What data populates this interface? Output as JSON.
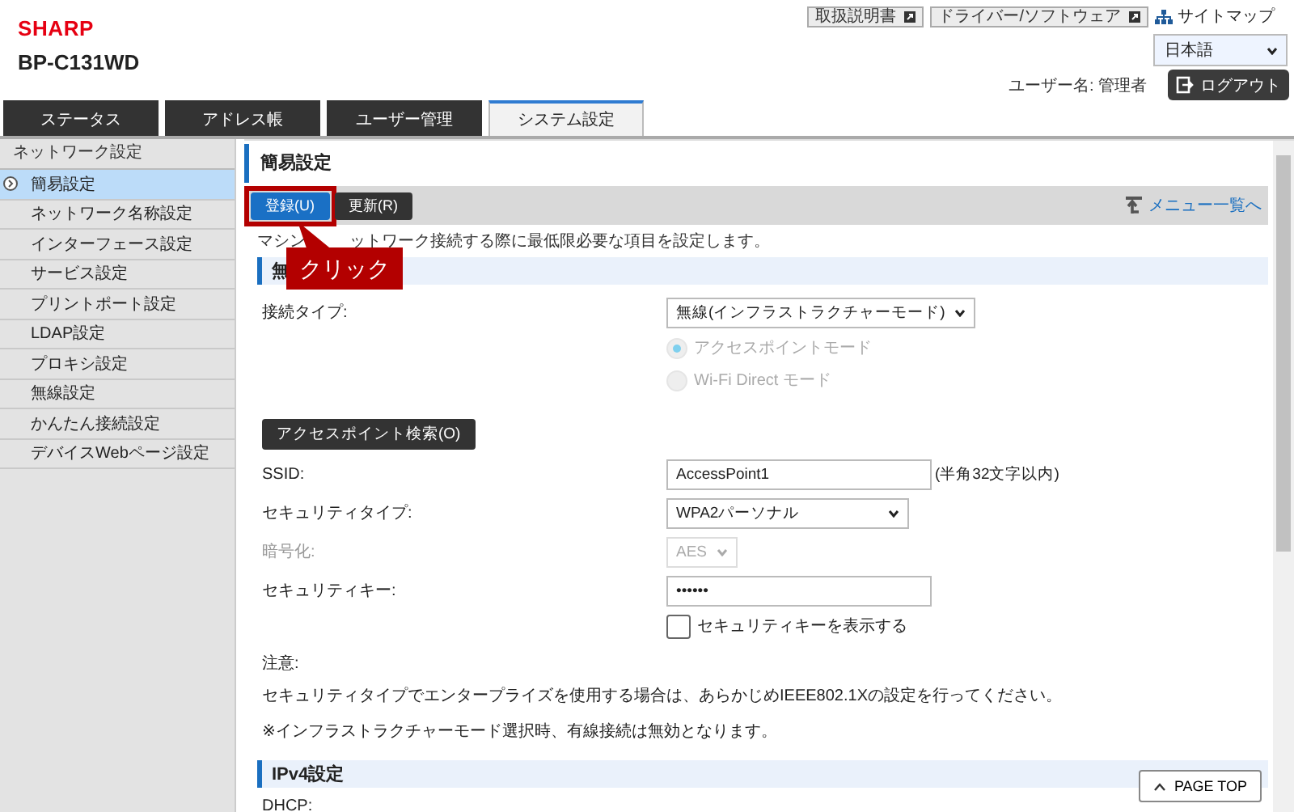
{
  "header": {
    "logo": "SHARP",
    "model": "BP-C131WD",
    "links": [
      {
        "label": "取扱説明書",
        "kind": "external"
      },
      {
        "label": "ドライバー/ソフトウェア",
        "kind": "external"
      },
      {
        "label": "サイトマップ",
        "kind": "sitemap"
      }
    ],
    "language": "日本語",
    "user_label": "ユーザー名: 管理者",
    "logout": "ログアウト"
  },
  "tabs": [
    {
      "label": "ステータス",
      "selected": false
    },
    {
      "label": "アドレス帳",
      "selected": false
    },
    {
      "label": "ユーザー管理",
      "selected": false
    },
    {
      "label": "システム設定",
      "selected": true
    }
  ],
  "sidebar": {
    "heading": "ネットワーク設定",
    "items": [
      {
        "label": "簡易設定",
        "selected": true
      },
      {
        "label": "ネットワーク名称設定",
        "selected": false
      },
      {
        "label": "インターフェース設定",
        "selected": false
      },
      {
        "label": "サービス設定",
        "selected": false
      },
      {
        "label": "プリントポート設定",
        "selected": false
      },
      {
        "label": "LDAP設定",
        "selected": false
      },
      {
        "label": "プロキシ設定",
        "selected": false
      },
      {
        "label": "無線設定",
        "selected": false
      },
      {
        "label": "かんたん接続設定",
        "selected": false
      },
      {
        "label": "デバイスWebページ設定",
        "selected": false
      }
    ]
  },
  "page": {
    "title": "簡易設定",
    "buttons": [
      {
        "label": "登録(U)",
        "kind": "primary",
        "highlighted": true
      },
      {
        "label": "更新(R)",
        "kind": "secondary",
        "highlighted": false
      }
    ],
    "menu_link": "メニュー一覧へ",
    "description_parts": [
      "マシン",
      "ットワーク接続する際に最低限必要な項目を設定します。"
    ],
    "section": "無",
    "callout": "クリック",
    "form": [
      {
        "kind": "select",
        "label": "接続タイプ:",
        "value": "無線(インフラストラクチャーモード)",
        "disabled": false
      },
      {
        "kind": "radio",
        "label": "アクセスポイントモード",
        "selected": true,
        "disabled": true
      },
      {
        "kind": "radio",
        "label": "Wi-Fi Direct モード",
        "selected": false,
        "disabled": true
      },
      {
        "kind": "button",
        "label": "アクセスポイント検索(O)",
        "disabled": false
      },
      {
        "kind": "input",
        "label": "SSID:",
        "value": "AccessPoint1",
        "hint": "(半角32文字以内)",
        "disabled": false
      },
      {
        "kind": "select",
        "label": "セキュリティタイプ:",
        "value": "WPA2パーソナル",
        "disabled": false
      },
      {
        "kind": "select",
        "label": "暗号化:",
        "value": "AES",
        "disabled": true
      },
      {
        "kind": "input",
        "label": "セキュリティキー:",
        "value": "••••••",
        "disabled": false
      },
      {
        "kind": "checkbox",
        "label": "セキュリティキーを表示する",
        "checked": false,
        "disabled": false
      }
    ],
    "notes": {
      "heading": "注意:",
      "lines": [
        "セキュリティタイプでエンタープライズを使用する場合は、あらかじめIEEE802.1Xの設定を行ってください。",
        "※インフラストラクチャーモード選択時、有線接続は無効となります。"
      ]
    },
    "section2": "IPv4設定",
    "next_label": "DHCP:",
    "page_top": "PAGE TOP"
  }
}
